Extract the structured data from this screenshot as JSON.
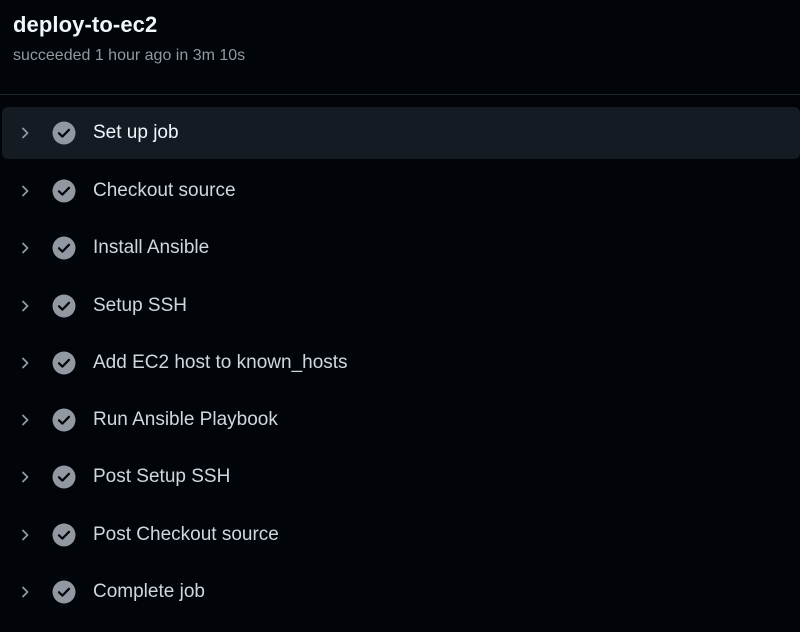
{
  "job": {
    "title": "deploy-to-ec2",
    "subtitle": "succeeded 1 hour ago in 3m 10s"
  },
  "icons": {
    "expand": "chevron-right-icon",
    "status": "check-circle-fill-icon"
  },
  "colors": {
    "background": "#010409",
    "active_row": "#151b23",
    "check_icon": "#9198a1",
    "title_text": "#f0f6fc",
    "muted_text": "#9198a1"
  },
  "steps": [
    {
      "label": "Set up job",
      "status": "success",
      "active": true
    },
    {
      "label": "Checkout source",
      "status": "success"
    },
    {
      "label": "Install Ansible",
      "status": "success"
    },
    {
      "label": "Setup SSH",
      "status": "success"
    },
    {
      "label": "Add EC2 host to known_hosts",
      "status": "success"
    },
    {
      "label": "Run Ansible Playbook",
      "status": "success"
    },
    {
      "label": "Post Setup SSH",
      "status": "success"
    },
    {
      "label": "Post Checkout source",
      "status": "success"
    },
    {
      "label": "Complete job",
      "status": "success"
    }
  ]
}
